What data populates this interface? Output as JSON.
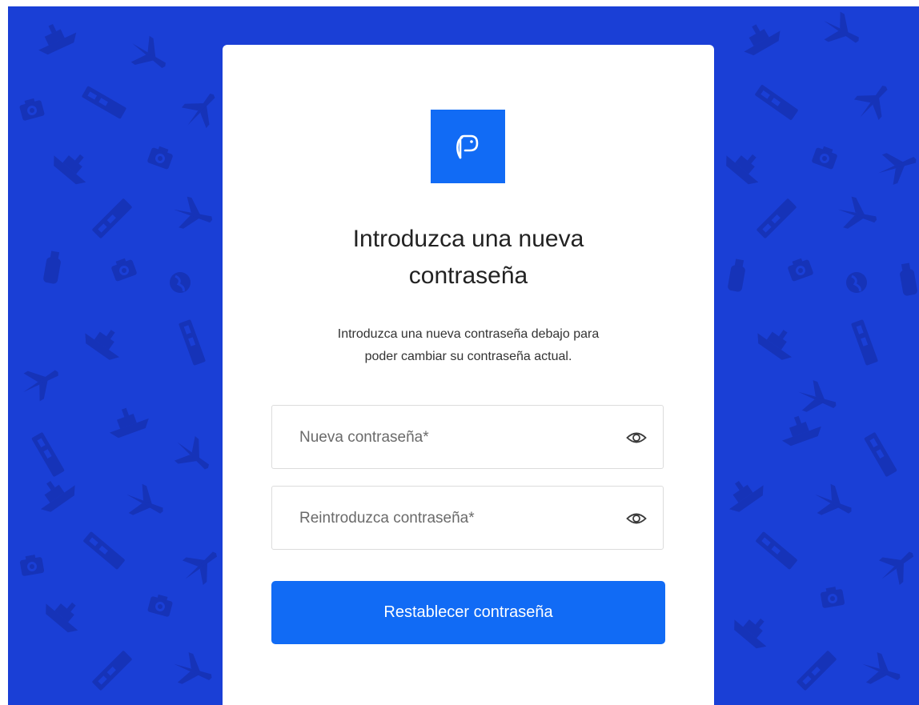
{
  "logo": {
    "icon": "p-logo-icon",
    "bg_color": "#116bf5"
  },
  "title": {
    "line1": "Introduzca una nueva",
    "line2": "contraseña"
  },
  "description": {
    "line1": "Introduzca una nueva contraseña debajo para",
    "line2": "poder cambiar su contraseña actual."
  },
  "fields": {
    "new_password": {
      "placeholder": "Nueva contraseña*",
      "value": "",
      "toggle_icon": "eye-icon"
    },
    "confirm_password": {
      "placeholder": "Reintroduzca contraseña*",
      "value": "",
      "toggle_icon": "eye-icon"
    }
  },
  "submit": {
    "label": "Restablecer contraseña"
  },
  "colors": {
    "background": "#1a3fd6",
    "accent": "#116bf5",
    "card": "#ffffff"
  }
}
